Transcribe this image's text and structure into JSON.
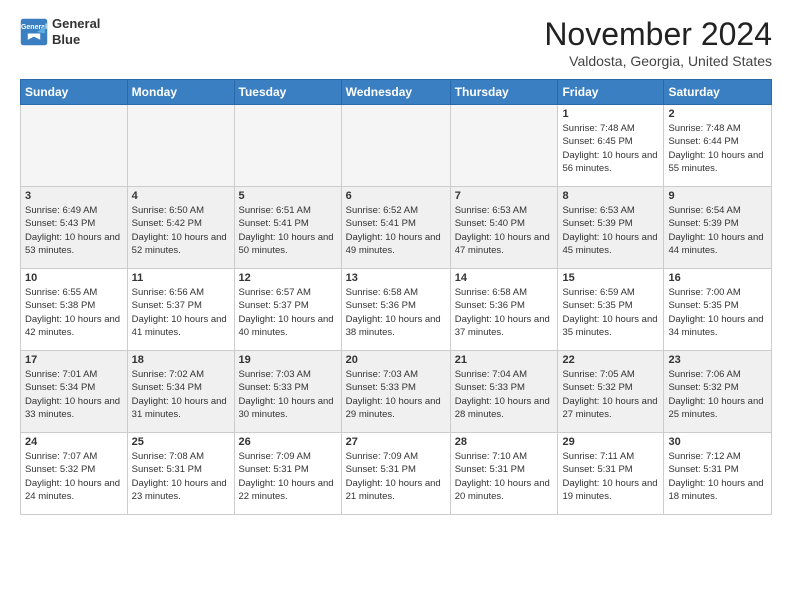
{
  "logo": {
    "line1": "General",
    "line2": "Blue"
  },
  "month": "November 2024",
  "location": "Valdosta, Georgia, United States",
  "weekdays": [
    "Sunday",
    "Monday",
    "Tuesday",
    "Wednesday",
    "Thursday",
    "Friday",
    "Saturday"
  ],
  "weeks": [
    [
      {
        "day": "",
        "empty": true
      },
      {
        "day": "",
        "empty": true
      },
      {
        "day": "",
        "empty": true
      },
      {
        "day": "",
        "empty": true
      },
      {
        "day": "",
        "empty": true
      },
      {
        "day": "1",
        "sunrise": "7:48 AM",
        "sunset": "6:45 PM",
        "daylight": "10 hours and 56 minutes."
      },
      {
        "day": "2",
        "sunrise": "7:48 AM",
        "sunset": "6:44 PM",
        "daylight": "10 hours and 55 minutes."
      }
    ],
    [
      {
        "day": "3",
        "sunrise": "6:49 AM",
        "sunset": "5:43 PM",
        "daylight": "10 hours and 53 minutes."
      },
      {
        "day": "4",
        "sunrise": "6:50 AM",
        "sunset": "5:42 PM",
        "daylight": "10 hours and 52 minutes."
      },
      {
        "day": "5",
        "sunrise": "6:51 AM",
        "sunset": "5:41 PM",
        "daylight": "10 hours and 50 minutes."
      },
      {
        "day": "6",
        "sunrise": "6:52 AM",
        "sunset": "5:41 PM",
        "daylight": "10 hours and 49 minutes."
      },
      {
        "day": "7",
        "sunrise": "6:53 AM",
        "sunset": "5:40 PM",
        "daylight": "10 hours and 47 minutes."
      },
      {
        "day": "8",
        "sunrise": "6:53 AM",
        "sunset": "5:39 PM",
        "daylight": "10 hours and 45 minutes."
      },
      {
        "day": "9",
        "sunrise": "6:54 AM",
        "sunset": "5:39 PM",
        "daylight": "10 hours and 44 minutes."
      }
    ],
    [
      {
        "day": "10",
        "sunrise": "6:55 AM",
        "sunset": "5:38 PM",
        "daylight": "10 hours and 42 minutes."
      },
      {
        "day": "11",
        "sunrise": "6:56 AM",
        "sunset": "5:37 PM",
        "daylight": "10 hours and 41 minutes."
      },
      {
        "day": "12",
        "sunrise": "6:57 AM",
        "sunset": "5:37 PM",
        "daylight": "10 hours and 40 minutes."
      },
      {
        "day": "13",
        "sunrise": "6:58 AM",
        "sunset": "5:36 PM",
        "daylight": "10 hours and 38 minutes."
      },
      {
        "day": "14",
        "sunrise": "6:58 AM",
        "sunset": "5:36 PM",
        "daylight": "10 hours and 37 minutes."
      },
      {
        "day": "15",
        "sunrise": "6:59 AM",
        "sunset": "5:35 PM",
        "daylight": "10 hours and 35 minutes."
      },
      {
        "day": "16",
        "sunrise": "7:00 AM",
        "sunset": "5:35 PM",
        "daylight": "10 hours and 34 minutes."
      }
    ],
    [
      {
        "day": "17",
        "sunrise": "7:01 AM",
        "sunset": "5:34 PM",
        "daylight": "10 hours and 33 minutes."
      },
      {
        "day": "18",
        "sunrise": "7:02 AM",
        "sunset": "5:34 PM",
        "daylight": "10 hours and 31 minutes."
      },
      {
        "day": "19",
        "sunrise": "7:03 AM",
        "sunset": "5:33 PM",
        "daylight": "10 hours and 30 minutes."
      },
      {
        "day": "20",
        "sunrise": "7:03 AM",
        "sunset": "5:33 PM",
        "daylight": "10 hours and 29 minutes."
      },
      {
        "day": "21",
        "sunrise": "7:04 AM",
        "sunset": "5:33 PM",
        "daylight": "10 hours and 28 minutes."
      },
      {
        "day": "22",
        "sunrise": "7:05 AM",
        "sunset": "5:32 PM",
        "daylight": "10 hours and 27 minutes."
      },
      {
        "day": "23",
        "sunrise": "7:06 AM",
        "sunset": "5:32 PM",
        "daylight": "10 hours and 25 minutes."
      }
    ],
    [
      {
        "day": "24",
        "sunrise": "7:07 AM",
        "sunset": "5:32 PM",
        "daylight": "10 hours and 24 minutes."
      },
      {
        "day": "25",
        "sunrise": "7:08 AM",
        "sunset": "5:31 PM",
        "daylight": "10 hours and 23 minutes."
      },
      {
        "day": "26",
        "sunrise": "7:09 AM",
        "sunset": "5:31 PM",
        "daylight": "10 hours and 22 minutes."
      },
      {
        "day": "27",
        "sunrise": "7:09 AM",
        "sunset": "5:31 PM",
        "daylight": "10 hours and 21 minutes."
      },
      {
        "day": "28",
        "sunrise": "7:10 AM",
        "sunset": "5:31 PM",
        "daylight": "10 hours and 20 minutes."
      },
      {
        "day": "29",
        "sunrise": "7:11 AM",
        "sunset": "5:31 PM",
        "daylight": "10 hours and 19 minutes."
      },
      {
        "day": "30",
        "sunrise": "7:12 AM",
        "sunset": "5:31 PM",
        "daylight": "10 hours and 18 minutes."
      }
    ]
  ]
}
